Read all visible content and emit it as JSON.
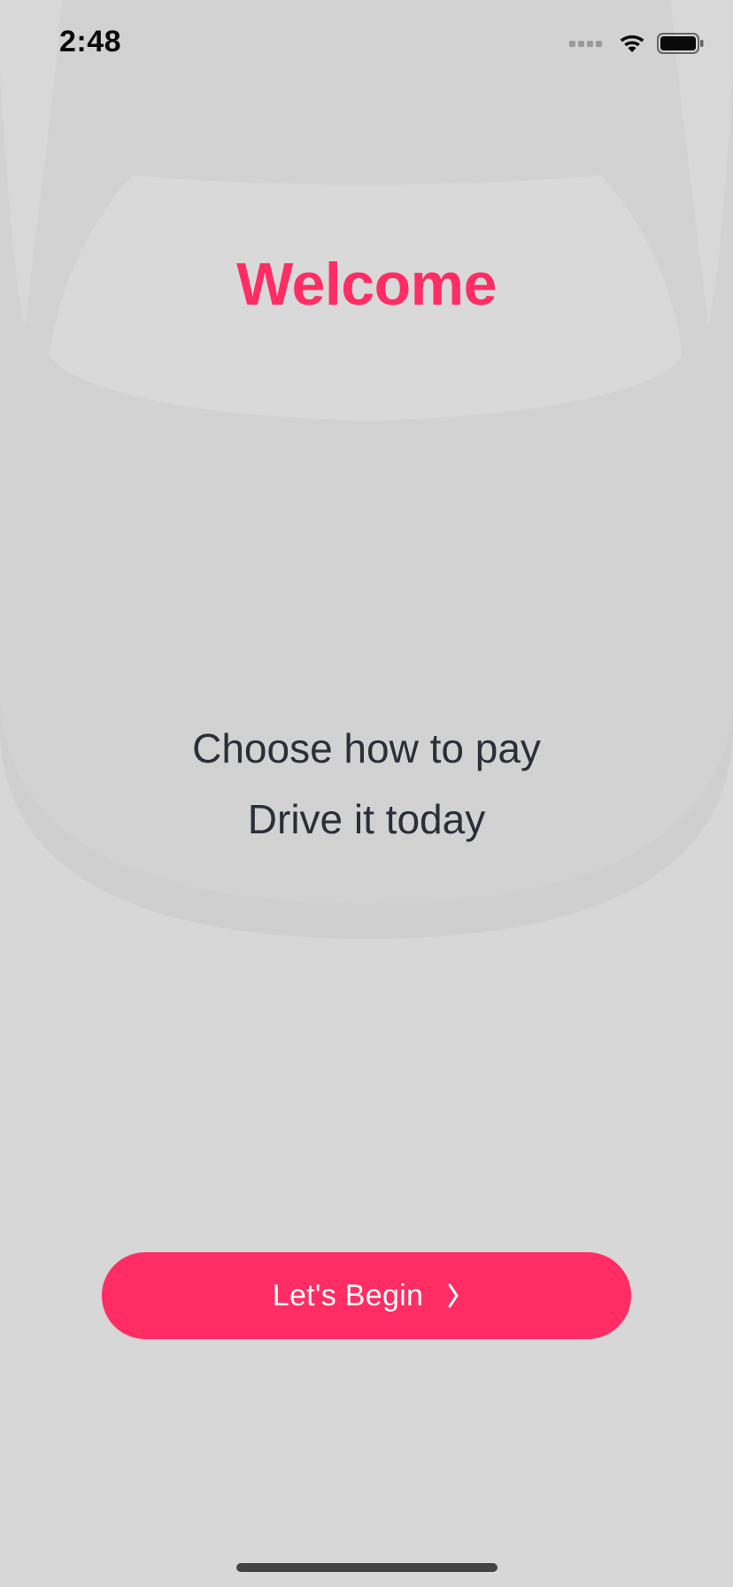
{
  "status_bar": {
    "time": "2:48",
    "icons": [
      "cellular-signal-icon",
      "wifi-icon",
      "battery-icon"
    ]
  },
  "welcome": {
    "title": "Welcome",
    "line1": "Choose how to pay",
    "line2": "Drive it today"
  },
  "cta": {
    "label": "Let's Begin",
    "icon": "chevron-right-icon"
  },
  "colors": {
    "accent": "#ff2d63",
    "background": "#d7d7d7",
    "text": "#2b2f3a"
  }
}
